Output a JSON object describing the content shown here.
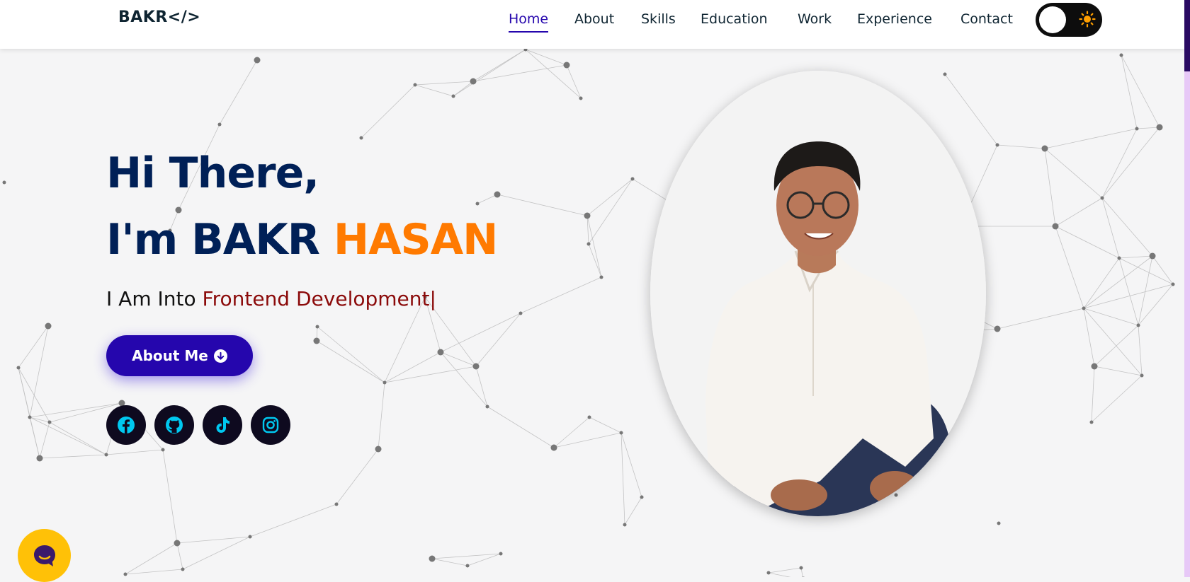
{
  "header": {
    "logo_text": "BAKR</>",
    "nav": [
      {
        "label": "Home",
        "active": true
      },
      {
        "label": "About",
        "active": false
      },
      {
        "label": "Skills",
        "active": false
      },
      {
        "label": "Education",
        "active": false
      },
      {
        "label": "Work",
        "active": false
      },
      {
        "label": "Experience",
        "active": false
      },
      {
        "label": "Contact",
        "active": false
      }
    ],
    "theme_toggle": {
      "state": "light",
      "icon": "sun-icon"
    }
  },
  "hero": {
    "greeting": "Hi There,",
    "intro_prefix": "I'm BAKR ",
    "intro_accent": "HASAN",
    "typed_prefix": "I Am Into ",
    "typed_role": "Frontend Development|",
    "about_button_label": "About Me",
    "socials": [
      {
        "name": "facebook-icon"
      },
      {
        "name": "github-icon"
      },
      {
        "name": "tiktok-icon"
      },
      {
        "name": "instagram-icon"
      }
    ]
  },
  "chat_widget": {
    "icon": "chat-icon"
  },
  "colors": {
    "navy": "#002057",
    "accent_orange": "#ff7a00",
    "role_red": "#8b0a0a",
    "button_blue": "#2506ad",
    "social_icon": "#00c8f0",
    "chat_yellow": "#ffc107"
  }
}
